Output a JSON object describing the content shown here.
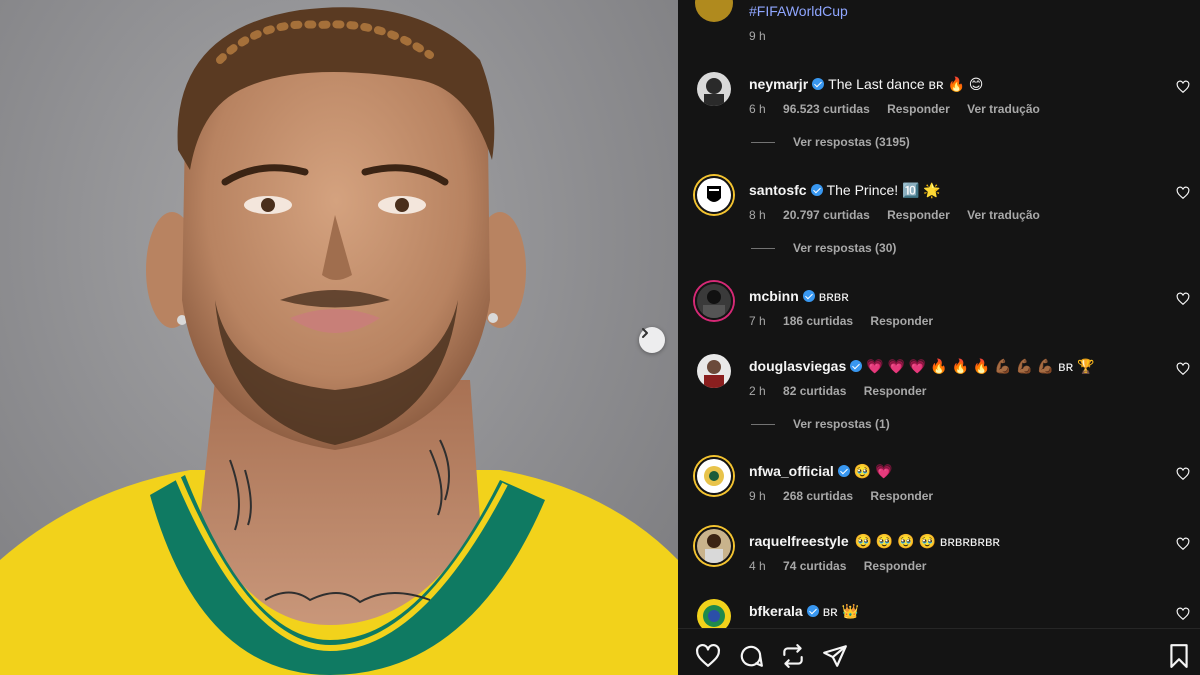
{
  "post": {
    "caption_hashtag": "#FIFAWorldCup",
    "caption_time": "9 h"
  },
  "comments": [
    {
      "username": "neymarjr",
      "verified": true,
      "text": "The Last dance ʙʀ 🔥 😊",
      "time": "6 h",
      "likes": "96.523 curtidas",
      "reply": "Responder",
      "translate": "Ver tradução",
      "view_replies": "Ver respostas (3195)"
    },
    {
      "username": "santosfc",
      "verified": true,
      "text": "The Prince! 🔟 🌟",
      "time": "8 h",
      "likes": "20.797 curtidas",
      "reply": "Responder",
      "translate": "Ver tradução",
      "view_replies": "Ver respostas (30)"
    },
    {
      "username": "mcbinn",
      "verified": true,
      "text": "ʙʀʙʀ",
      "time": "7 h",
      "likes": "186 curtidas",
      "reply": "Responder"
    },
    {
      "username": "douglasviegas",
      "verified": true,
      "text": "💗 💗 💗 🔥 🔥 🔥 💪🏾 💪🏾 💪🏾 ʙʀ 🏆",
      "time": "2 h",
      "likes": "82 curtidas",
      "reply": "Responder",
      "view_replies": "Ver respostas (1)"
    },
    {
      "username": "nfwa_official",
      "verified": true,
      "text": "🥹 💗",
      "time": "9 h",
      "likes": "268 curtidas",
      "reply": "Responder"
    },
    {
      "username": "raquelfreestyle",
      "verified": false,
      "text": "🥹 🥹 🥹 🥹 ʙʀʙʀʙʀʙʀ",
      "time": "4 h",
      "likes": "74 curtidas",
      "reply": "Responder"
    },
    {
      "username": "bfkerala",
      "verified": true,
      "text": "ʙʀ 👑"
    }
  ],
  "icons": [
    "chevron-right-icon",
    "heart-icon",
    "comment-icon",
    "share-icon",
    "send-icon",
    "bookmark-icon"
  ],
  "colors": {
    "panel_bg": "#141414",
    "hashtag": "#8fa6ff",
    "verified": "#3897f0",
    "secondary_text": "#a8a8a8",
    "jersey_yellow": "#f2d21b",
    "collar_green": "#0f7a62"
  }
}
